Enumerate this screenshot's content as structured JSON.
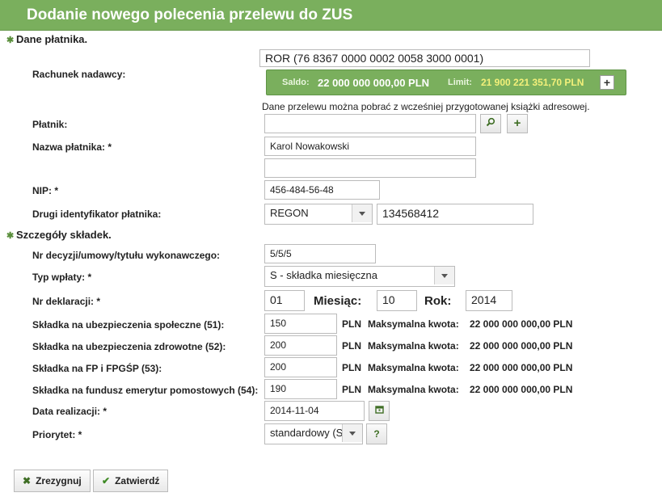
{
  "title": "Dodanie nowego polecenia przelewu do ZUS",
  "sections": {
    "payer": "Dane płatnika.",
    "contributions": "Szczegóły składek."
  },
  "payer": {
    "account_label": "Rachunek nadawcy:",
    "account_value": "ROR (76 8367 0000 0002 0058 3000 0001)",
    "saldo_label": "Saldo:",
    "saldo_value": "22 000 000 000,00 PLN",
    "limit_label": "Limit:",
    "limit_value": "21 900 221 351,70 PLN",
    "addressbook_note": "Dane przelewu można pobrać z wcześniej przygotowanej książki adresowej.",
    "platnik_label": "Płatnik:",
    "platnik_value": "",
    "name_label": "Nazwa płatnika: *",
    "name_value": "Karol Nowakowski",
    "name_value2": "",
    "nip_label": "NIP: *",
    "nip_value": "456-484-56-48",
    "id2_label": "Drugi identyfikator płatnika:",
    "id2_type": "REGON",
    "id2_value": "134568412"
  },
  "contrib": {
    "decision_label": "Nr decyzji/umowy/tytułu wykonawczego:",
    "decision_value": "5/5/5",
    "type_label": "Typ wpłaty: *",
    "type_value": "S - składka miesięczna",
    "decl_label": "Nr deklaracji: *",
    "decl_value": "01",
    "month_label": "Miesiąc:",
    "month_value": "10",
    "year_label": "Rok:",
    "year_value": "2014",
    "currency": "PLN",
    "max_label": "Maksymalna kwota:",
    "rows": [
      {
        "label": "Składka na ubezpieczenia społeczne (51):",
        "value": "150",
        "max": "22 000 000 000,00 PLN"
      },
      {
        "label": "Składka na ubezpieczenia zdrowotne (52):",
        "value": "200",
        "max": "22 000 000 000,00 PLN"
      },
      {
        "label": "Składka na FP i FPGŚP (53):",
        "value": "200",
        "max": "22 000 000 000,00 PLN"
      },
      {
        "label": "Składka na fundusz emerytur pomostowych (54):",
        "value": "190",
        "max": "22 000 000 000,00 PLN"
      }
    ],
    "date_label": "Data realizacji: *",
    "date_value": "2014-11-04",
    "priority_label": "Priorytet: *",
    "priority_value": "standardowy (S)",
    "help_label": "?"
  },
  "buttons": {
    "cancel": "Zrezygnuj",
    "confirm": "Zatwierdź"
  },
  "icons": {
    "search": "magnifier-icon",
    "add": "plus-icon",
    "calendar": "calendar-icon",
    "cancel": "x-icon",
    "confirm": "checkmark-icon"
  },
  "colors": {
    "header": "#7aaf5d",
    "limit_text": "#f3f07a"
  }
}
